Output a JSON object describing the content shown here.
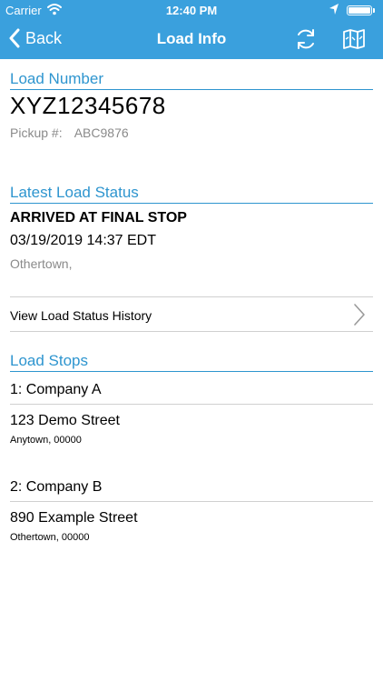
{
  "status_bar": {
    "carrier": "Carrier",
    "time": "12:40 PM"
  },
  "nav": {
    "back_label": "Back",
    "title": "Load Info"
  },
  "load": {
    "section_title": "Load Number",
    "number": "XYZ12345678",
    "pickup_label": "Pickup #:",
    "pickup_value": "ABC9876"
  },
  "latest_status": {
    "section_title": "Latest Load Status",
    "status": "ARRIVED AT FINAL STOP",
    "datetime": "03/19/2019 14:37 EDT",
    "location": "Othertown,",
    "history_link": "View Load Status History"
  },
  "stops": {
    "section_title": "Load Stops",
    "items": [
      {
        "name": "1: Company A",
        "street": "123 Demo Street",
        "city": "Anytown,  00000"
      },
      {
        "name": "2: Company B",
        "street": "890 Example Street",
        "city": "Othertown,  00000"
      }
    ]
  },
  "colors": {
    "brand": "#3aa0dd",
    "section_accent": "#2e95cf",
    "muted_text": "#8a8a8a",
    "divider": "#d0d0d0"
  },
  "icons": {
    "wifi": "wifi-icon",
    "location": "location-arrow-icon",
    "battery": "battery-icon",
    "back": "chevron-left-icon",
    "refresh": "refresh-icon",
    "map": "map-icon",
    "disclosure": "chevron-right-icon"
  }
}
